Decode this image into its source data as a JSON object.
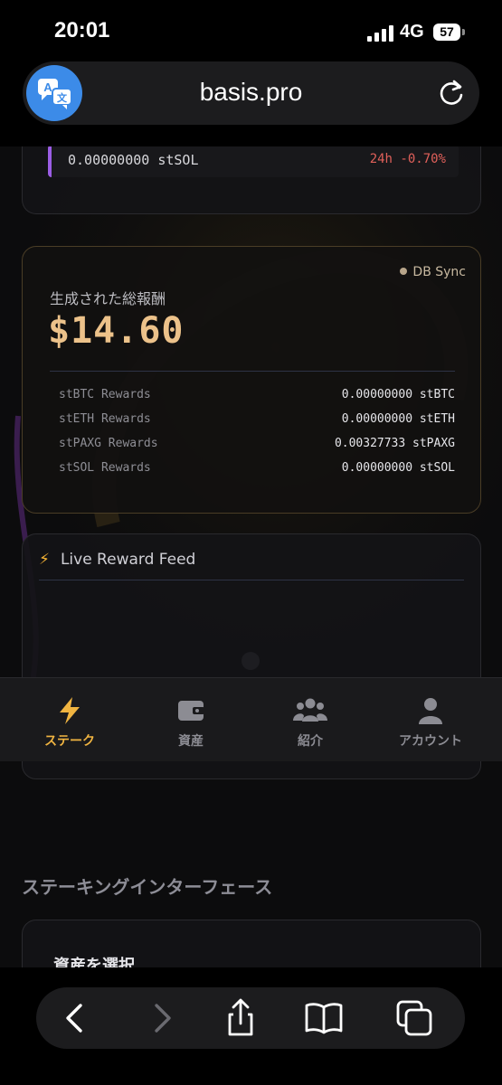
{
  "status_bar": {
    "time": "20:01",
    "network": "4G",
    "battery": "57"
  },
  "browser": {
    "url": "basis.pro"
  },
  "asset_card": {
    "amount": "0.00000000 stSOL",
    "change": "24h -0.70%"
  },
  "rewards": {
    "status": "DB Sync",
    "title": "生成された総報酬",
    "total": "$14.60",
    "rows": [
      {
        "label": "stBTC Rewards",
        "value": "0.00000000 stBTC"
      },
      {
        "label": "stETH Rewards",
        "value": "0.00000000 stETH"
      },
      {
        "label": "stPAXG Rewards",
        "value": "0.00327733 stPAXG"
      },
      {
        "label": "stSOL Rewards",
        "value": "0.00000000 stSOL"
      }
    ]
  },
  "feed": {
    "title": "Live Reward Feed"
  },
  "tabs": [
    {
      "label": "ステーク",
      "icon": "bolt-icon",
      "active": true
    },
    {
      "label": "資産",
      "icon": "wallet-icon",
      "active": false
    },
    {
      "label": "紹介",
      "icon": "users-icon",
      "active": false
    },
    {
      "label": "アカウント",
      "icon": "account-icon",
      "active": false
    }
  ],
  "staking": {
    "section_title": "ステーキングインターフェース",
    "select_label": "資産を選択"
  },
  "colors": {
    "accent": "#f0b441",
    "gold_amount": "#ecc28a",
    "negative": "#e0605a",
    "purple_marker": "#9b5de5",
    "translate_blue": "#3c8be8"
  }
}
